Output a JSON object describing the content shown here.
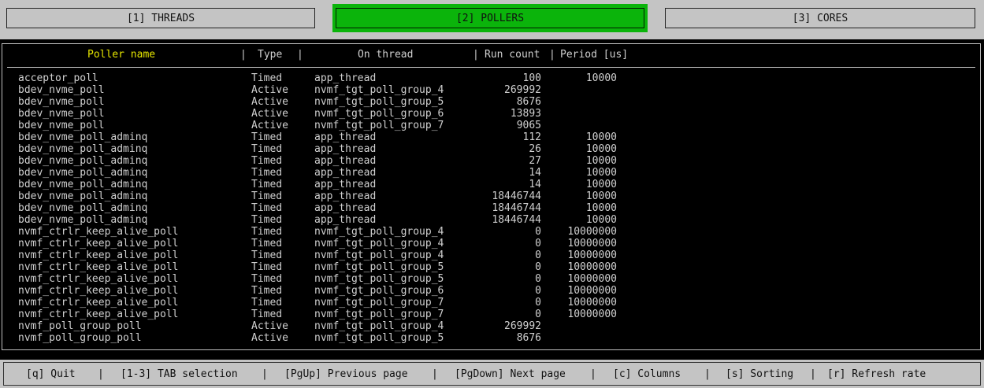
{
  "tabs": [
    {
      "label": "[1] THREADS",
      "active": false
    },
    {
      "label": "[2] POLLERS",
      "active": true
    },
    {
      "label": "[3] CORES",
      "active": false
    }
  ],
  "table": {
    "headers": {
      "name": "Poller name",
      "type": "Type",
      "thread": "On thread",
      "run": "Run count",
      "period": "Period [us]"
    },
    "rows": [
      {
        "name": "acceptor_poll",
        "type": "Timed",
        "thread": "app_thread",
        "run": "100",
        "period": "10000"
      },
      {
        "name": "bdev_nvme_poll",
        "type": "Active",
        "thread": "nvmf_tgt_poll_group_4",
        "run": "269992",
        "period": ""
      },
      {
        "name": "bdev_nvme_poll",
        "type": "Active",
        "thread": "nvmf_tgt_poll_group_5",
        "run": "8676",
        "period": ""
      },
      {
        "name": "bdev_nvme_poll",
        "type": "Active",
        "thread": "nvmf_tgt_poll_group_6",
        "run": "13893",
        "period": ""
      },
      {
        "name": "bdev_nvme_poll",
        "type": "Active",
        "thread": "nvmf_tgt_poll_group_7",
        "run": "9065",
        "period": ""
      },
      {
        "name": "bdev_nvme_poll_adminq",
        "type": "Timed",
        "thread": "app_thread",
        "run": "112",
        "period": "10000"
      },
      {
        "name": "bdev_nvme_poll_adminq",
        "type": "Timed",
        "thread": "app_thread",
        "run": "26",
        "period": "10000"
      },
      {
        "name": "bdev_nvme_poll_adminq",
        "type": "Timed",
        "thread": "app_thread",
        "run": "27",
        "period": "10000"
      },
      {
        "name": "bdev_nvme_poll_adminq",
        "type": "Timed",
        "thread": "app_thread",
        "run": "14",
        "period": "10000"
      },
      {
        "name": "bdev_nvme_poll_adminq",
        "type": "Timed",
        "thread": "app_thread",
        "run": "14",
        "period": "10000"
      },
      {
        "name": "bdev_nvme_poll_adminq",
        "type": "Timed",
        "thread": "app_thread",
        "run": "18446744",
        "period": "10000"
      },
      {
        "name": "bdev_nvme_poll_adminq",
        "type": "Timed",
        "thread": "app_thread",
        "run": "18446744",
        "period": "10000"
      },
      {
        "name": "bdev_nvme_poll_adminq",
        "type": "Timed",
        "thread": "app_thread",
        "run": "18446744",
        "period": "10000"
      },
      {
        "name": "nvmf_ctrlr_keep_alive_poll",
        "type": "Timed",
        "thread": "nvmf_tgt_poll_group_4",
        "run": "0",
        "period": "10000000"
      },
      {
        "name": "nvmf_ctrlr_keep_alive_poll",
        "type": "Timed",
        "thread": "nvmf_tgt_poll_group_4",
        "run": "0",
        "period": "10000000"
      },
      {
        "name": "nvmf_ctrlr_keep_alive_poll",
        "type": "Timed",
        "thread": "nvmf_tgt_poll_group_4",
        "run": "0",
        "period": "10000000"
      },
      {
        "name": "nvmf_ctrlr_keep_alive_poll",
        "type": "Timed",
        "thread": "nvmf_tgt_poll_group_5",
        "run": "0",
        "period": "10000000"
      },
      {
        "name": "nvmf_ctrlr_keep_alive_poll",
        "type": "Timed",
        "thread": "nvmf_tgt_poll_group_5",
        "run": "0",
        "period": "10000000"
      },
      {
        "name": "nvmf_ctrlr_keep_alive_poll",
        "type": "Timed",
        "thread": "nvmf_tgt_poll_group_6",
        "run": "0",
        "period": "10000000"
      },
      {
        "name": "nvmf_ctrlr_keep_alive_poll",
        "type": "Timed",
        "thread": "nvmf_tgt_poll_group_7",
        "run": "0",
        "period": "10000000"
      },
      {
        "name": "nvmf_ctrlr_keep_alive_poll",
        "type": "Timed",
        "thread": "nvmf_tgt_poll_group_7",
        "run": "0",
        "period": "10000000"
      },
      {
        "name": "nvmf_poll_group_poll",
        "type": "Active",
        "thread": "nvmf_tgt_poll_group_4",
        "run": "269992",
        "period": ""
      },
      {
        "name": "nvmf_poll_group_poll",
        "type": "Active",
        "thread": "nvmf_tgt_poll_group_5",
        "run": "8676",
        "period": ""
      }
    ]
  },
  "footer": {
    "items": [
      {
        "label": "[q] Quit"
      },
      {
        "label": "[1-3] TAB selection"
      },
      {
        "label": "[PgUp] Previous page"
      },
      {
        "label": "[PgDown] Next page"
      },
      {
        "label": "[c] Columns"
      },
      {
        "label": "[s] Sorting"
      },
      {
        "label": "[r] Refresh rate"
      }
    ],
    "separator": "|"
  },
  "colors": {
    "active_tab": "#0bb40b",
    "header_highlight": "#e6e600",
    "chrome": "#c4c4c4",
    "background": "#000000"
  }
}
